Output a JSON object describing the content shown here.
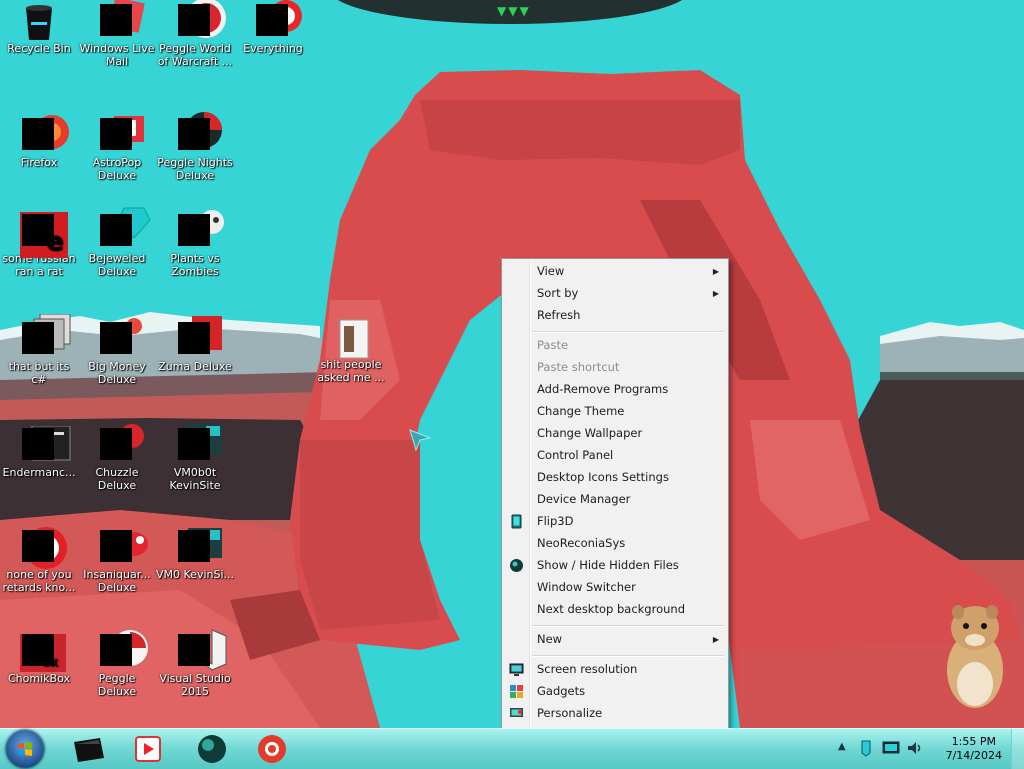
{
  "desktop": {
    "icons": [
      {
        "id": "recycle-bin",
        "label": "Recycle Bin",
        "icon": "recycle-bin-icon"
      },
      {
        "id": "windows-live-mail",
        "label": "Windows Live Mail",
        "icon": "mail-icon"
      },
      {
        "id": "peggle-world-of-warcraft",
        "label": "Peggle World of Warcraft ...",
        "icon": "peggle-icon"
      },
      {
        "id": "everything",
        "label": "Everything",
        "icon": "search-icon"
      },
      {
        "id": "firefox",
        "label": "Firefox",
        "icon": "firefox-icon"
      },
      {
        "id": "astropop-deluxe",
        "label": "AstroPop Deluxe",
        "icon": "game-icon"
      },
      {
        "id": "peggle-nights-deluxe",
        "label": "Peggle Nights Deluxe",
        "icon": "peggle-icon"
      },
      {
        "id": "some-russian",
        "label": "some russian ran a rat",
        "icon": "app-icon"
      },
      {
        "id": "bejeweled-deluxe",
        "label": "Bejeweled Deluxe",
        "icon": "gem-icon"
      },
      {
        "id": "plants-vs-zombies",
        "label": "Plants vs Zombies",
        "icon": "game-icon"
      },
      {
        "id": "that-but-its-c",
        "label": "that but its c#",
        "icon": "stack-icon"
      },
      {
        "id": "big-money-deluxe",
        "label": "Big Money Deluxe",
        "icon": "game-icon"
      },
      {
        "id": "zuma-deluxe",
        "label": "Zuma Deluxe",
        "icon": "game-icon"
      },
      {
        "id": "shit-people",
        "label": "shit people asked me ...",
        "icon": "file-icon"
      },
      {
        "id": "endermanch",
        "label": "Endermanc...",
        "icon": "window-icon"
      },
      {
        "id": "chuzzle-deluxe",
        "label": "Chuzzle Deluxe",
        "icon": "game-icon"
      },
      {
        "id": "vm0b0t-kevinsite",
        "label": "VM0b0t KevinSite",
        "icon": "vm-icon"
      },
      {
        "id": "none-of-you",
        "label": "none of you retards kno...",
        "icon": "app-icon"
      },
      {
        "id": "insaniquarium-deluxe",
        "label": "Insaniquar... Deluxe",
        "icon": "fish-icon"
      },
      {
        "id": "vm0-kevinsi",
        "label": "VM0 KevinSi...",
        "icon": "vm-icon"
      },
      {
        "id": "chomikbox",
        "label": "ChomikBox",
        "icon": "box-icon"
      },
      {
        "id": "peggle-deluxe",
        "label": "Peggle Deluxe",
        "icon": "peggle-icon"
      },
      {
        "id": "visual-studio-2015",
        "label": "Visual Studio 2015",
        "icon": "visual-studio-icon"
      }
    ]
  },
  "context_menu": {
    "items": [
      {
        "label": "View",
        "disabled": false,
        "submenu": true,
        "icon": ""
      },
      {
        "label": "Sort by",
        "disabled": false,
        "submenu": true,
        "icon": ""
      },
      {
        "label": "Refresh",
        "disabled": false,
        "submenu": false,
        "icon": ""
      },
      {
        "label": "Paste",
        "disabled": true,
        "submenu": false,
        "icon": ""
      },
      {
        "label": "Paste shortcut",
        "disabled": true,
        "submenu": false,
        "icon": ""
      },
      {
        "label": "Add-Remove Programs",
        "disabled": false,
        "submenu": false,
        "icon": ""
      },
      {
        "label": "Change Theme",
        "disabled": false,
        "submenu": false,
        "icon": ""
      },
      {
        "label": "Change Wallpaper",
        "disabled": false,
        "submenu": false,
        "icon": ""
      },
      {
        "label": "Control Panel",
        "disabled": false,
        "submenu": false,
        "icon": ""
      },
      {
        "label": "Desktop Icons Settings",
        "disabled": false,
        "submenu": false,
        "icon": ""
      },
      {
        "label": "Device Manager",
        "disabled": false,
        "submenu": false,
        "icon": ""
      },
      {
        "label": "Flip3D",
        "disabled": false,
        "submenu": false,
        "icon": "flip3d-icon"
      },
      {
        "label": "NeoReconiaSys",
        "disabled": false,
        "submenu": false,
        "icon": ""
      },
      {
        "label": "Show / Hide Hidden Files",
        "disabled": false,
        "submenu": false,
        "icon": "globe-icon"
      },
      {
        "label": "Window Switcher",
        "disabled": false,
        "submenu": false,
        "icon": ""
      },
      {
        "label": "Next desktop background",
        "disabled": false,
        "submenu": false,
        "icon": ""
      },
      {
        "label": "New",
        "disabled": false,
        "submenu": true,
        "icon": ""
      },
      {
        "label": "Screen resolution",
        "disabled": false,
        "submenu": false,
        "icon": "monitor-icon"
      },
      {
        "label": "Gadgets",
        "disabled": false,
        "submenu": false,
        "icon": "gadgets-icon"
      },
      {
        "label": "Personalize",
        "disabled": false,
        "submenu": false,
        "icon": "personalize-icon"
      }
    ]
  },
  "taskbar": {
    "start_icon": "windows-logo-icon",
    "pinned": [
      {
        "id": "explorer",
        "icon": "folder-icon"
      },
      {
        "id": "media-player",
        "icon": "media-player-icon"
      },
      {
        "id": "browser-globe",
        "icon": "globe-icon"
      },
      {
        "id": "firefox",
        "icon": "firefox-icon"
      }
    ],
    "tray": {
      "time": "1:55 PM",
      "date": "7/14/2024",
      "icons": [
        "show-hidden-icons-arrow",
        "action-center-icon",
        "network-icon",
        "volume-icon"
      ]
    }
  },
  "colors": {
    "sky": "#35d6d6",
    "rock": "#d94a4a",
    "taskbar": "#6fd7d3",
    "menu_bg": "#f1f1f1"
  }
}
